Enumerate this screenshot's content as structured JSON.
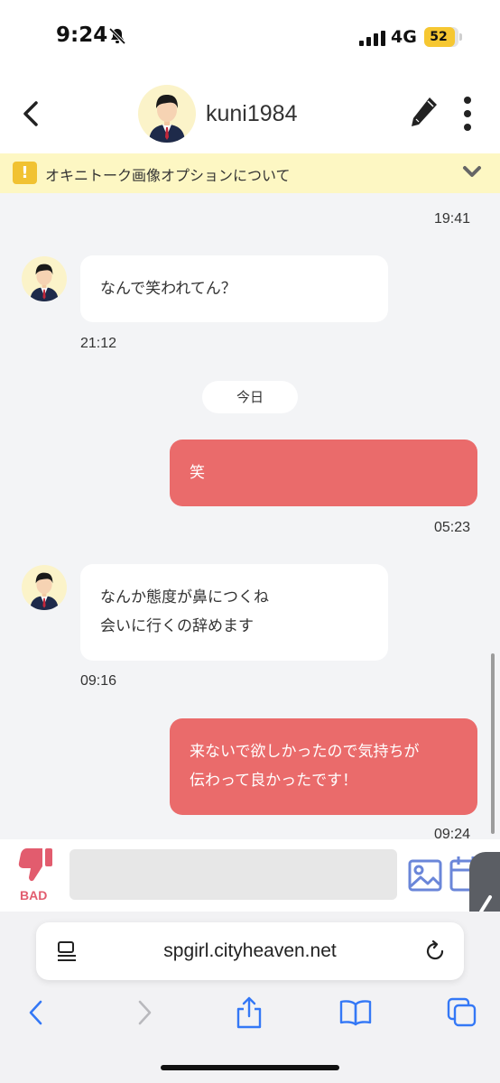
{
  "status_bar": {
    "time": "9:24",
    "network": "4G",
    "battery": "52",
    "battery_level": 0.52
  },
  "header": {
    "username": "kuni1984"
  },
  "notice": {
    "text": "オキニトーク画像オプションについて"
  },
  "chat": {
    "top_timestamp": "19:41",
    "date_divider": "今日",
    "messages": [
      {
        "side": "in",
        "lines": [
          "なんで笑われてん？"
        ],
        "time": "21:12"
      },
      {
        "side": "out",
        "lines": [
          "笑"
        ],
        "time": "05:23"
      },
      {
        "side": "in",
        "lines": [
          "なんか態度が鼻につくね",
          "会いに行くの辞めます"
        ],
        "time": "09:16"
      },
      {
        "side": "out",
        "lines": [
          "来ないで欲しかったので気持ちが",
          "伝わって良かったです！"
        ],
        "time": "09:24"
      }
    ]
  },
  "input_bar": {
    "bad_label": "BAD",
    "message_value": ""
  },
  "safari": {
    "url": "spgirl.cityheaven.net"
  },
  "colors": {
    "accent_pink": "#ea6b6b",
    "notice_bg": "#fdf7c3",
    "icon_blue": "#3478f6",
    "bad_pink": "#e25c6e"
  },
  "icons": [
    "bell-slash-icon",
    "signal-icon",
    "back-chevron-icon",
    "pencil-icon",
    "more-vertical-icon",
    "exclamation-icon",
    "chevron-down-icon",
    "thumbs-down-icon",
    "image-icon",
    "calendar-icon",
    "reader-icon",
    "reload-icon",
    "share-icon",
    "book-icon",
    "tabs-icon"
  ]
}
